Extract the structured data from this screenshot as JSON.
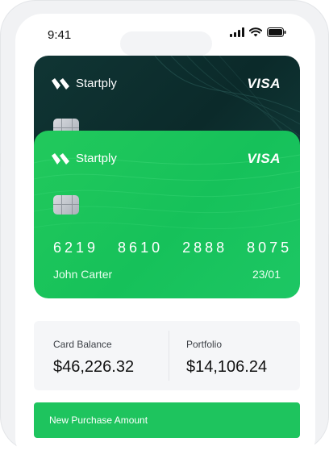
{
  "status_bar": {
    "time": "9:41"
  },
  "cards": {
    "back": {
      "brand": "Startply",
      "network": "VISA"
    },
    "front": {
      "brand": "Startply",
      "network": "VISA",
      "number_groups": [
        "6219",
        "8610",
        "2888",
        "8075"
      ],
      "holder": "John Carter",
      "expiry": "23/01"
    }
  },
  "balances": {
    "card_balance": {
      "label": "Card Balance",
      "value": "$46,226.32"
    },
    "portfolio": {
      "label": "Portfolio",
      "value": "$14,106.24"
    }
  },
  "actions": {
    "purchase_label": "New Purchase Amount"
  },
  "colors": {
    "card_front": "#16c15a",
    "card_back": "#0b2a2a",
    "accent": "#1ec45e"
  }
}
